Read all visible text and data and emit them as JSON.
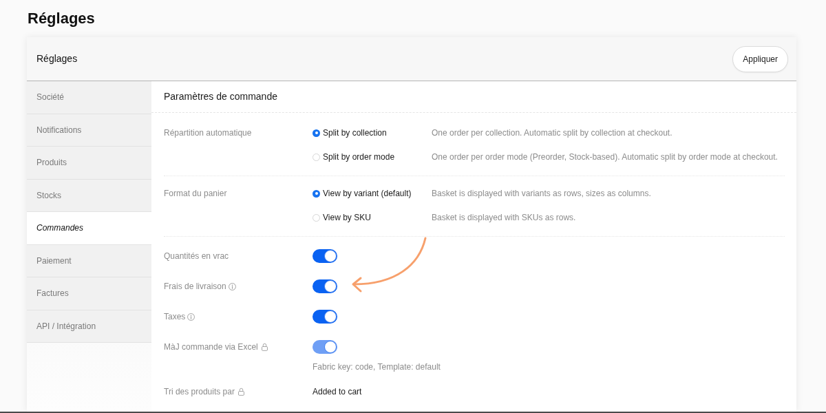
{
  "page": {
    "title": "Réglages"
  },
  "panel": {
    "title": "Réglages",
    "apply_button": "Appliquer"
  },
  "sidebar": {
    "items": [
      {
        "label": "Société",
        "selected": false
      },
      {
        "label": "Notifications",
        "selected": false
      },
      {
        "label": "Produits",
        "selected": false
      },
      {
        "label": "Stocks",
        "selected": false
      },
      {
        "label": "Commandes",
        "selected": true
      },
      {
        "label": "Paiement",
        "selected": false
      },
      {
        "label": "Factures",
        "selected": false
      },
      {
        "label": "API / Intégration",
        "selected": false
      }
    ]
  },
  "section": {
    "title": "Paramètres de commande",
    "radio_groups": [
      {
        "label": "Répartition automatique",
        "options": [
          {
            "label": "Split by collection",
            "description": "One order per collection. Automatic split by collection at checkout.",
            "selected": true
          },
          {
            "label": "Split by order mode",
            "description": "One order per order mode (Preorder, Stock-based). Automatic split by order mode at checkout.",
            "selected": false
          }
        ]
      },
      {
        "label": "Format du panier",
        "options": [
          {
            "label": "View by variant (default)",
            "description": "Basket is displayed with variants as rows, sizes as columns.",
            "selected": true
          },
          {
            "label": "View by SKU",
            "description": "Basket is displayed with SKUs as rows.",
            "selected": false
          }
        ]
      }
    ],
    "settings": [
      {
        "kind": "toggle",
        "label": "Quantités en vrac",
        "info": false,
        "locked": false,
        "on": true,
        "disabled": false
      },
      {
        "kind": "toggle",
        "label": "Frais de livraison",
        "info": true,
        "locked": false,
        "on": true,
        "disabled": false
      },
      {
        "kind": "toggle",
        "label": "Taxes",
        "info": true,
        "locked": false,
        "on": true,
        "disabled": false
      },
      {
        "kind": "toggle",
        "label": "MàJ commande via Excel",
        "info": false,
        "locked": true,
        "on": true,
        "disabled": true,
        "hint": "Fabric key: code, Template: default"
      },
      {
        "kind": "value",
        "label": "Tri des produits par",
        "info": false,
        "locked": true,
        "value": "Added to cart"
      }
    ]
  }
}
